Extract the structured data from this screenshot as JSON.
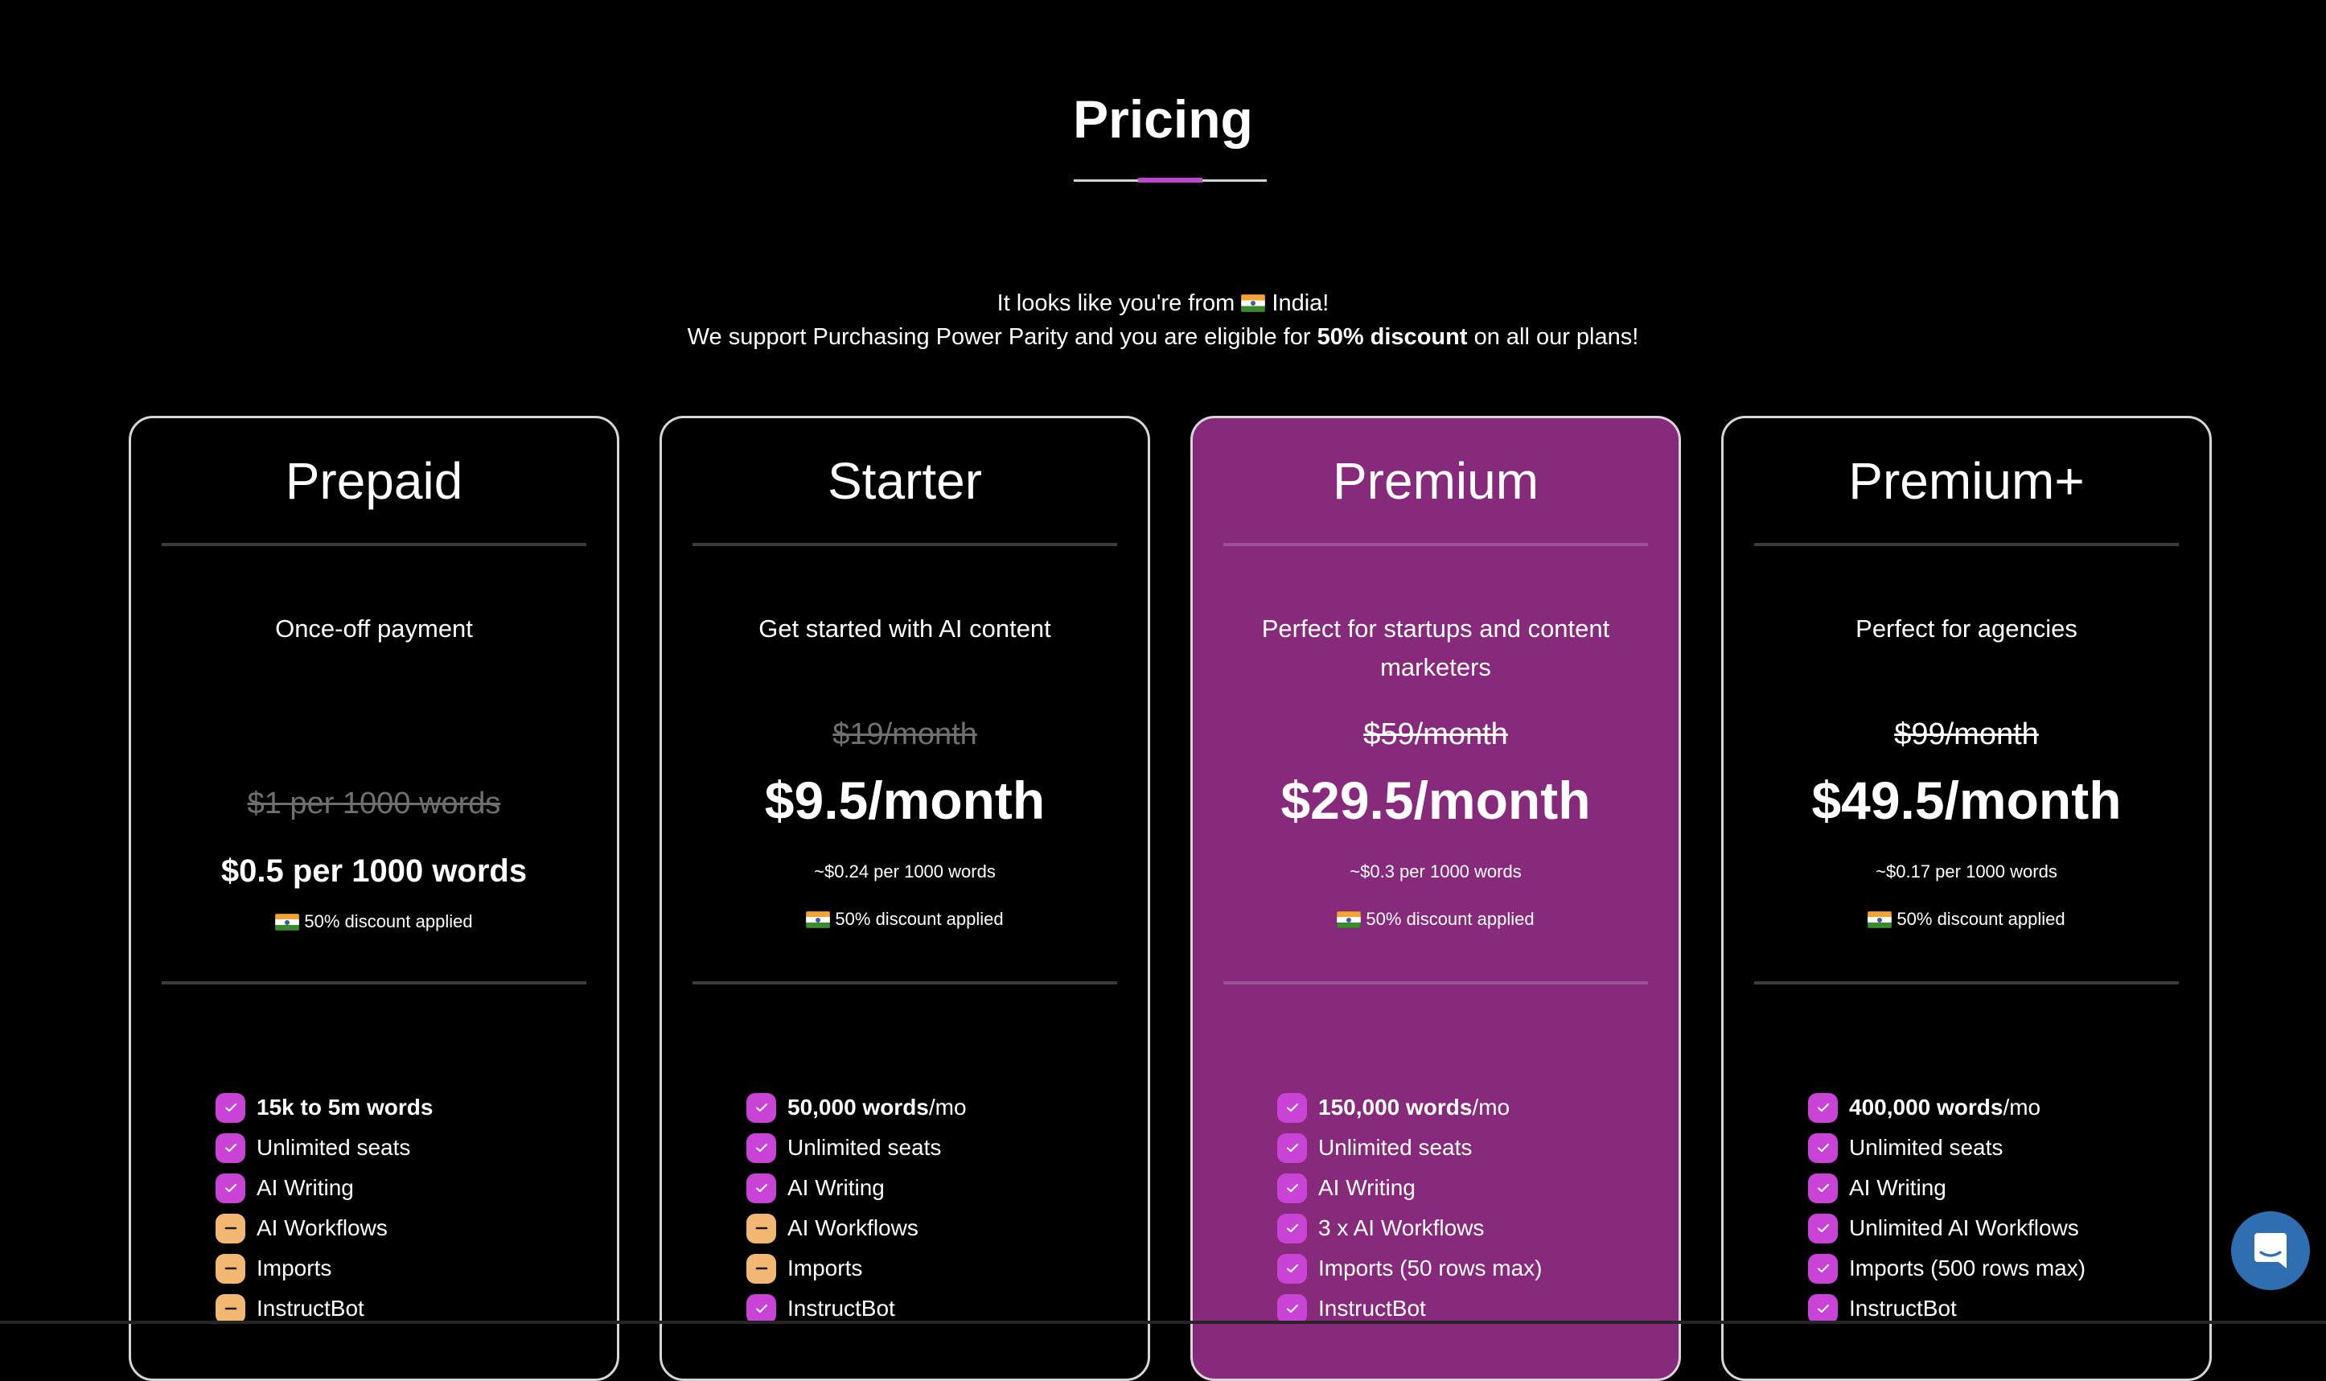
{
  "header": {
    "title": "Pricing"
  },
  "banner": {
    "line1_prefix": "It looks like you're from",
    "country_flag_icon": "india-flag-icon",
    "country": "India!",
    "line2_prefix": "We support Purchasing Power Parity and you are eligible for",
    "line2_bold": "50% discount",
    "line2_suffix": "on all our plans!"
  },
  "colors": {
    "accent": "#c644d4",
    "featured_card_bg": "#872a7b",
    "check_icon_bg": "#c944d6",
    "dash_icon_bg": "#f2b873",
    "chat_button_bg": "#2f6fb1"
  },
  "plans": [
    {
      "name": "Prepaid",
      "subtitle": "Once-off payment",
      "old_price": "$1 per 1000 words",
      "price": "$0.5 per 1000 words",
      "per_words": "",
      "discount_note": "50% discount applied",
      "featured": false,
      "features": [
        {
          "status": "check",
          "bold": "15k to 5m words",
          "text": ""
        },
        {
          "status": "check",
          "bold": "",
          "text": "Unlimited seats"
        },
        {
          "status": "check",
          "bold": "",
          "text": "AI Writing"
        },
        {
          "status": "dash",
          "bold": "",
          "text": "AI Workflows"
        },
        {
          "status": "dash",
          "bold": "",
          "text": "Imports"
        },
        {
          "status": "dash",
          "bold": "",
          "text": "InstructBot"
        }
      ]
    },
    {
      "name": "Starter",
      "subtitle": "Get started with AI content",
      "old_price": "$19/month",
      "price": "$9.5/month",
      "per_words": "~$0.24 per 1000 words",
      "discount_note": "50% discount applied",
      "featured": false,
      "features": [
        {
          "status": "check",
          "bold": "50,000 words",
          "text": "/mo"
        },
        {
          "status": "check",
          "bold": "",
          "text": "Unlimited seats"
        },
        {
          "status": "check",
          "bold": "",
          "text": "AI Writing"
        },
        {
          "status": "dash",
          "bold": "",
          "text": "AI Workflows"
        },
        {
          "status": "dash",
          "bold": "",
          "text": "Imports"
        },
        {
          "status": "check",
          "bold": "",
          "text": "InstructBot"
        }
      ]
    },
    {
      "name": "Premium",
      "subtitle": "Perfect for startups and content marketers",
      "old_price": "$59/month",
      "price": "$29.5/month",
      "per_words": "~$0.3 per 1000 words",
      "discount_note": "50% discount applied",
      "featured": true,
      "features": [
        {
          "status": "check",
          "bold": "150,000 words",
          "text": "/mo"
        },
        {
          "status": "check",
          "bold": "",
          "text": "Unlimited seats"
        },
        {
          "status": "check",
          "bold": "",
          "text": "AI Writing"
        },
        {
          "status": "check",
          "bold": "",
          "text": "3 x AI Workflows"
        },
        {
          "status": "check",
          "bold": "",
          "text": "Imports (50 rows max)"
        },
        {
          "status": "check",
          "bold": "",
          "text": "InstructBot"
        }
      ]
    },
    {
      "name": "Premium+",
      "subtitle": "Perfect for agencies",
      "old_price": "$99/month",
      "price": "$49.5/month",
      "per_words": "~$0.17 per 1000 words",
      "discount_note": "50% discount applied",
      "featured": false,
      "features": [
        {
          "status": "check",
          "bold": "400,000 words",
          "text": "/mo"
        },
        {
          "status": "check",
          "bold": "",
          "text": "Unlimited seats"
        },
        {
          "status": "check",
          "bold": "",
          "text": "AI Writing"
        },
        {
          "status": "check",
          "bold": "",
          "text": "Unlimited AI Workflows"
        },
        {
          "status": "check",
          "bold": "",
          "text": "Imports (500 rows max)"
        },
        {
          "status": "check",
          "bold": "",
          "text": "InstructBot"
        }
      ]
    }
  ],
  "chat_widget": {
    "icon": "chat-bubble-icon"
  }
}
